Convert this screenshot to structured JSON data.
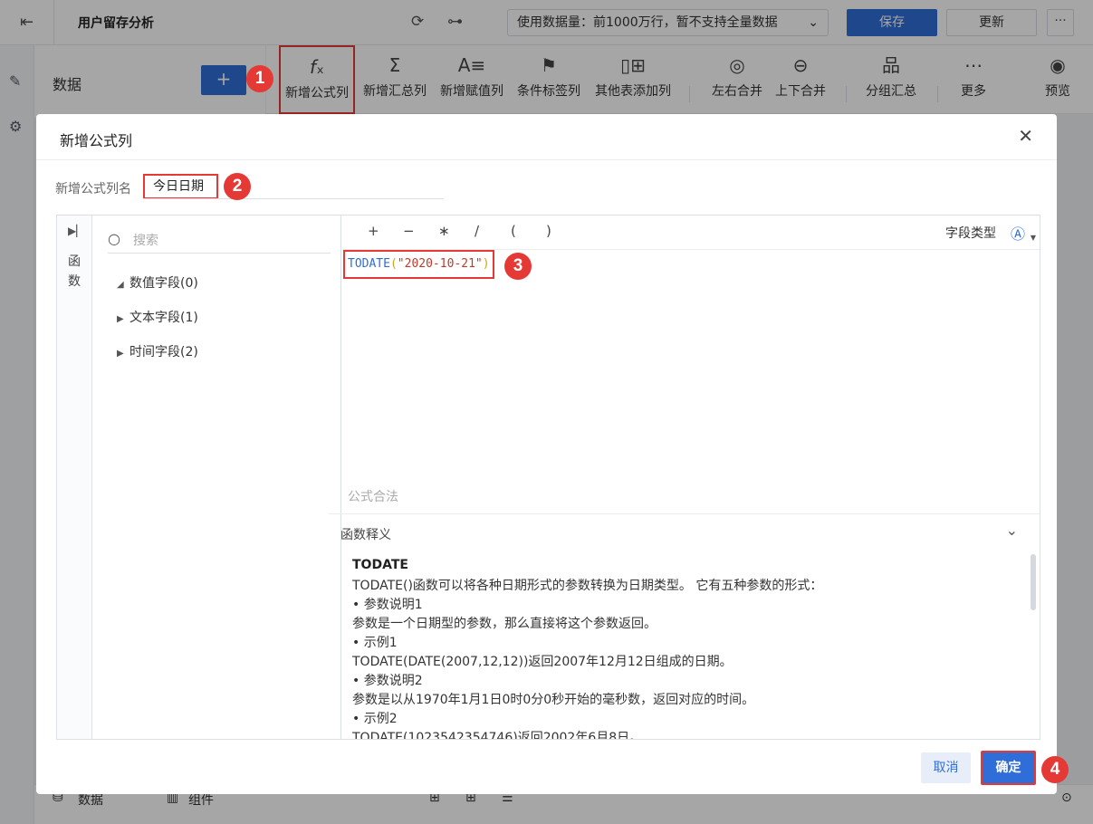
{
  "topbar": {
    "title": "用户留存分析",
    "dataset_label": "使用数据量：前1000万行，暂不支持全量数据",
    "save_label": "保存",
    "update_label": "更新",
    "more_label": "···"
  },
  "data_panel": {
    "label": "数据",
    "add_label": "+"
  },
  "toolbar": {
    "items": [
      {
        "label": "新增公式列",
        "icon": "fx-icon"
      },
      {
        "label": "新增汇总列",
        "icon": "sigma-icon"
      },
      {
        "label": "新增赋值列",
        "icon": "assign-icon"
      },
      {
        "label": "条件标签列",
        "icon": "flag-icon"
      },
      {
        "label": "其他表添加列",
        "icon": "add-column-icon"
      },
      {
        "label": "左右合并",
        "icon": "merge-horizontal-icon"
      },
      {
        "label": "上下合并",
        "icon": "merge-vertical-icon"
      },
      {
        "label": "分组汇总",
        "icon": "group-icon"
      },
      {
        "label": "更多",
        "icon": "more-icon"
      },
      {
        "label": "预览",
        "icon": "preview-icon"
      }
    ]
  },
  "bottombar": {
    "tab_data": "数据",
    "tab_component": "组件"
  },
  "badges": [
    "1",
    "2",
    "3",
    "4"
  ],
  "dialog": {
    "title": "新增公式列",
    "name_label": "新增公式列名",
    "name_value": "今日日期",
    "function_rail_label": "函数",
    "search_placeholder": "搜索",
    "tree": [
      {
        "label": "数值字段(0)",
        "expanded": true
      },
      {
        "label": "文本字段(1)",
        "expanded": false
      },
      {
        "label": "时间字段(2)",
        "expanded": false
      }
    ],
    "operators": [
      "+",
      "−",
      "∗",
      "/",
      "(",
      ")"
    ],
    "field_type_label": "字段类型",
    "formula": {
      "fn": "TODATE",
      "open": "(",
      "arg": "\"2020-10-21\"",
      "close": ")"
    },
    "validity": "公式合法",
    "explain_title": "函数释义",
    "explain_fn": "TODATE",
    "explain_lines": [
      "TODATE()函数可以将各种日期形式的参数转换为日期类型。 它有五种参数的形式：",
      "• 参数说明1",
      "参数是一个日期型的参数，那么直接将这个参数返回。",
      "• 示例1",
      "TODATE(DATE(2007,12,12))返回2007年12月12日组成的日期。",
      "• 参数说明2",
      "参数是以从1970年1月1日0时0分0秒开始的毫秒数，返回对应的时间。",
      "• 示例2",
      "TODATE(1023542354746)返回2002年6月8日。"
    ],
    "cancel_label": "取消",
    "ok_label": "确定"
  }
}
